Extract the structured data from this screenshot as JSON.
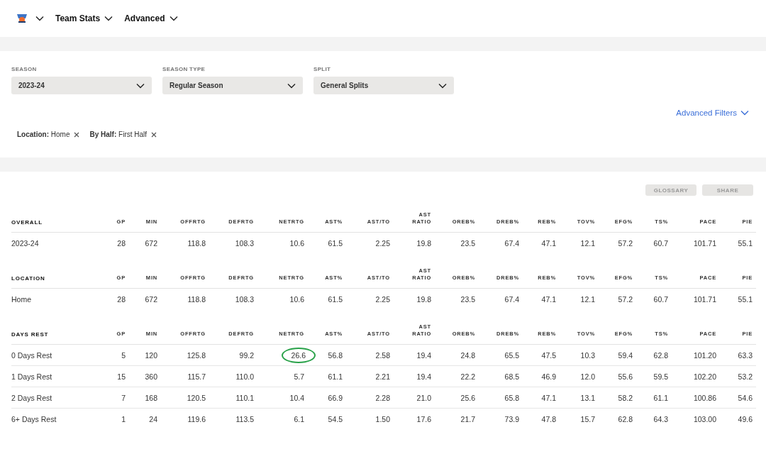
{
  "nav": {
    "items": [
      "Team Stats",
      "Advanced"
    ]
  },
  "filters": [
    {
      "label": "SEASON",
      "value": "2023-24"
    },
    {
      "label": "SEASON TYPE",
      "value": "Regular Season"
    },
    {
      "label": "SPLIT",
      "value": "General Splits"
    }
  ],
  "advanced_filters": "Advanced Filters",
  "chips": [
    {
      "key": "Location:",
      "value": "Home"
    },
    {
      "key": "By Half:",
      "value": "First Half"
    }
  ],
  "actions": [
    "GLOSSARY",
    "SHARE"
  ],
  "sections": [
    {
      "title": "OVERALL",
      "columns": [
        "GP",
        "MIN",
        "OFFRTG",
        "DEFRTG",
        "NETRTG",
        "AST%",
        "AST/TO",
        "AST RATIO",
        "OREB%",
        "DREB%",
        "REB%",
        "TOV%",
        "EFG%",
        "TS%",
        "PACE",
        "PIE"
      ],
      "rows": [
        {
          "label": "2023-24",
          "cells": [
            "28",
            "672",
            "118.8",
            "108.3",
            "10.6",
            "61.5",
            "2.25",
            "19.8",
            "23.5",
            "67.4",
            "47.1",
            "12.1",
            "57.2",
            "60.7",
            "101.71",
            "55.1"
          ]
        }
      ]
    },
    {
      "title": "LOCATION",
      "columns": [
        "GP",
        "MIN",
        "OFFRTG",
        "DEFRTG",
        "NETRTG",
        "AST%",
        "AST/TO",
        "AST RATIO",
        "OREB%",
        "DREB%",
        "REB%",
        "TOV%",
        "EFG%",
        "TS%",
        "PACE",
        "PIE"
      ],
      "rows": [
        {
          "label": "Home",
          "cells": [
            "28",
            "672",
            "118.8",
            "108.3",
            "10.6",
            "61.5",
            "2.25",
            "19.8",
            "23.5",
            "67.4",
            "47.1",
            "12.1",
            "57.2",
            "60.7",
            "101.71",
            "55.1"
          ]
        }
      ]
    },
    {
      "title": "DAYS REST",
      "columns": [
        "GP",
        "MIN",
        "OFFRTG",
        "DEFRTG",
        "NETRTG",
        "AST%",
        "AST/TO",
        "AST RATIO",
        "OREB%",
        "DREB%",
        "REB%",
        "TOV%",
        "EFG%",
        "TS%",
        "PACE",
        "PIE"
      ],
      "rows": [
        {
          "label": "0 Days Rest",
          "cells": [
            "5",
            "120",
            "125.8",
            "99.2",
            {
              "value": "26.6",
              "circled": true
            },
            "56.8",
            "2.58",
            "19.4",
            "24.8",
            "65.5",
            "47.5",
            "10.3",
            "59.4",
            "62.8",
            "101.20",
            "63.3"
          ]
        },
        {
          "label": "1 Days Rest",
          "cells": [
            "15",
            "360",
            "115.7",
            "110.0",
            "5.7",
            "61.1",
            "2.21",
            "19.4",
            "22.2",
            "68.5",
            "46.9",
            "12.0",
            "55.6",
            "59.5",
            "102.20",
            "53.2"
          ]
        },
        {
          "label": "2 Days Rest",
          "cells": [
            "7",
            "168",
            "120.5",
            "110.1",
            "10.4",
            "66.9",
            "2.28",
            "21.0",
            "25.6",
            "65.8",
            "47.1",
            "13.1",
            "58.2",
            "61.1",
            "100.86",
            "54.6"
          ]
        },
        {
          "label": "6+ Days Rest",
          "cells": [
            "1",
            "24",
            "119.6",
            "113.5",
            "6.1",
            "54.5",
            "1.50",
            "17.6",
            "21.7",
            "73.9",
            "47.8",
            "15.7",
            "62.8",
            "64.3",
            "103.00",
            "49.6"
          ]
        }
      ]
    }
  ]
}
